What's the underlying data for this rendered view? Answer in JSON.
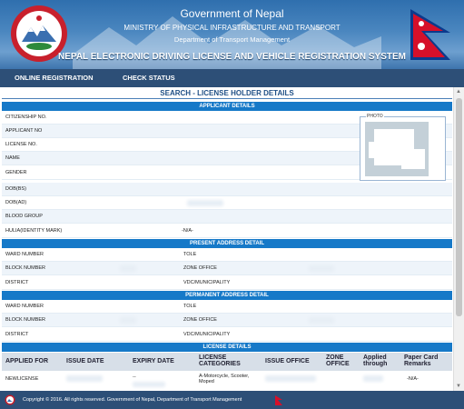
{
  "header": {
    "gov_title": "Government of Nepal",
    "ministry": "MINISTRY OF PHYSICAL INFRASTRUCTURE AND TRANSPORT",
    "department": "Department of Transport Management",
    "system_title": "NEPAL ELECTRONIC DRIVING LICENSE AND VEHICLE REGISTRATION SYSTEM"
  },
  "nav": {
    "online_registration": "ONLINE REGISTRATION",
    "check_status": "CHECK STATUS"
  },
  "page_title": "SEARCH - LICENSE HOLDER DETAILS",
  "sections": {
    "applicant": "APPLICANT DETAILS",
    "present": "PRESENT ADDRESS DETAIL",
    "permanent": "PERMANENT ADDRESS DETAIL",
    "license": "LICENSE DETAILS"
  },
  "applicant": {
    "citizenship_no": "CITIZENSHIP NO.",
    "applicant_no": "APPLICANT NO",
    "license_no": "LICENSE NO.",
    "name": "NAME",
    "gender": "GENDER",
    "dob_bs": "DOB(BS)",
    "dob_ad": "DOB(AD)",
    "blood_group": "BLOOD GROUP",
    "hulia": "HULIA(IDENTITY MARK)",
    "hulia_value": "-N/A-",
    "photo_label": "PHOTO"
  },
  "present_address": {
    "ward_number": "WARD NUMBER",
    "tole": "TOLE",
    "block_number": "BLOCK NUMBER",
    "zone_office": "ZONE OFFICE",
    "district": "DISTRICT",
    "vdc": "VDC/MUNICIPALITY"
  },
  "permanent_address": {
    "ward_number": "WARD NUMBER",
    "tole": "TOLE",
    "block_number": "BLOCK NUMBER",
    "zone_office": "ZONE OFFICE",
    "district": "DISTRICT",
    "vdc": "VDC/MUNICIPALITY"
  },
  "license_table": {
    "headers": [
      "APPLIED FOR",
      "ISSUE DATE",
      "EXPIRY DATE",
      "LICENSE CATEGORIES",
      "ISSUE OFFICE",
      "ZONE OFFICE",
      "Applied through",
      "Paper Card Remarks"
    ],
    "row": {
      "applied_for": "NEWLICENSE",
      "expiry_date": "--",
      "categories": "A-Motorcycle, Scooter, Moped",
      "remarks": "-N/A-"
    }
  },
  "footer": {
    "text": "Copyright © 2016. All rights reserved. Government of Nepal, Department of Transport Management"
  },
  "colors": {
    "header_blue": "#2f6fae",
    "nav_bar": "#2d4f77",
    "section_bar": "#1679c8",
    "alt_row": "#eef4fa",
    "title_blue": "#1f4f85"
  }
}
